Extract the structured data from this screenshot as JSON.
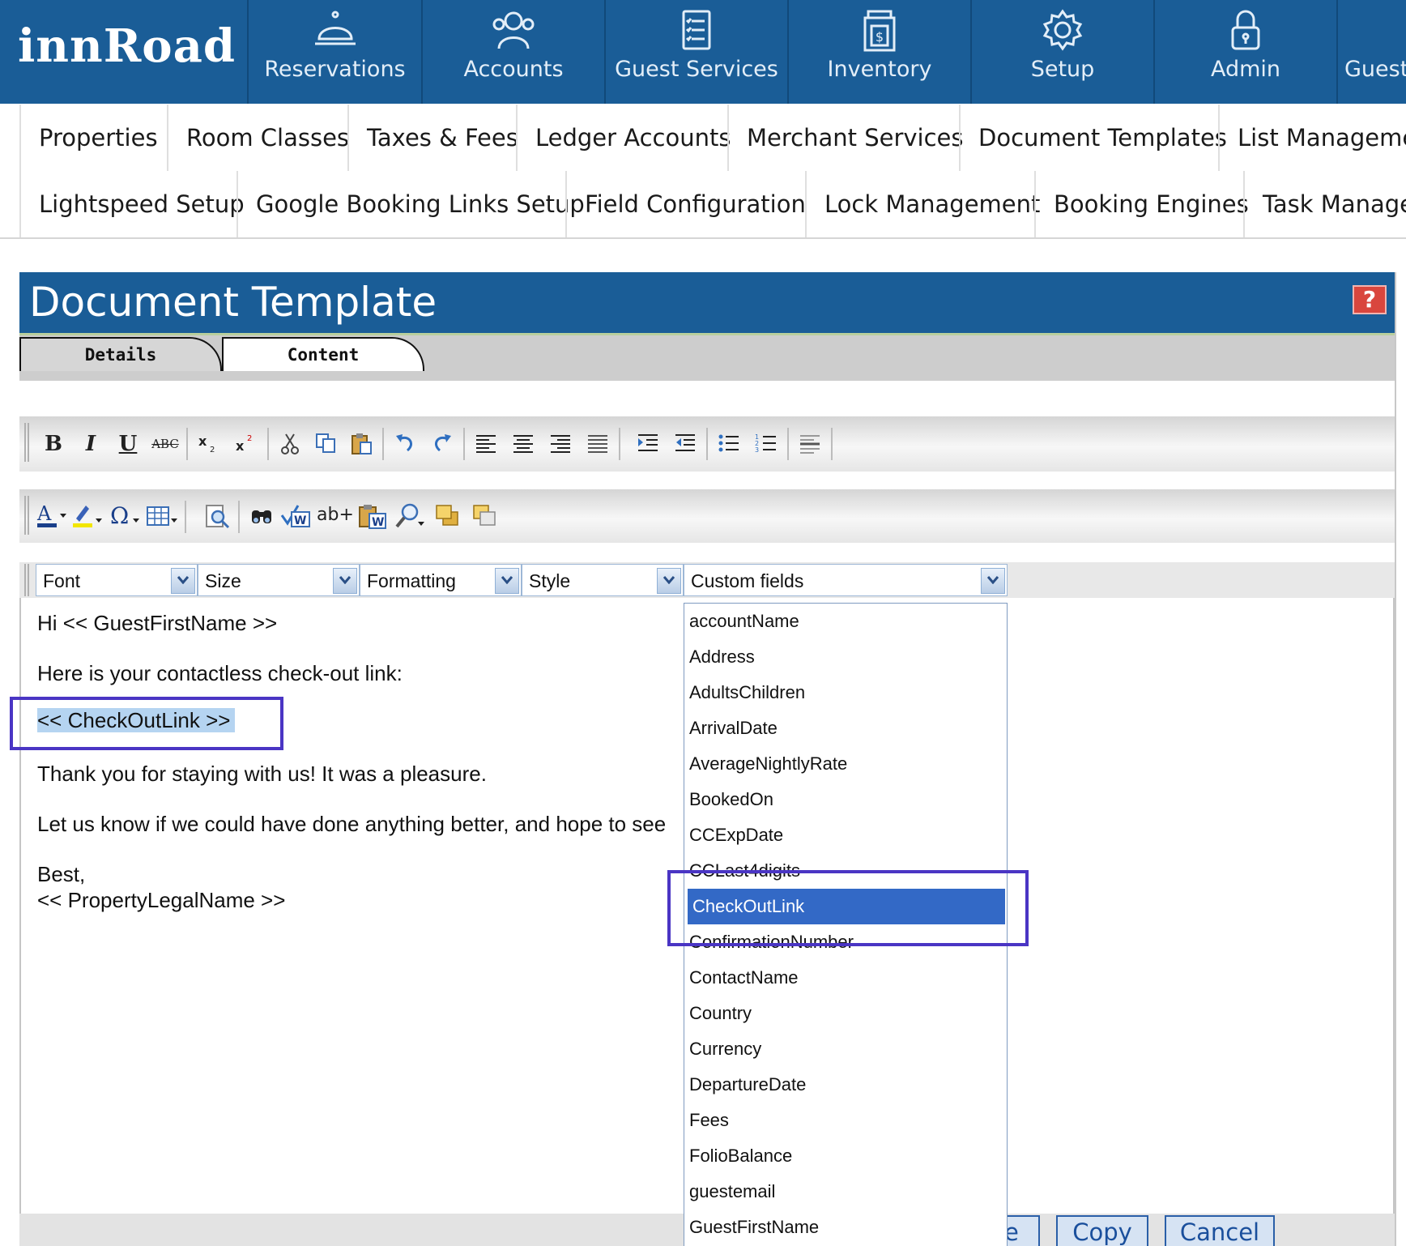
{
  "app": {
    "logo": "innRoad",
    "colors": {
      "nav_bg": "#1a5d97",
      "accent_highlight": "#4a35c4",
      "selected_option": "#3369c6",
      "text_selection": "#b5d4f1"
    }
  },
  "nav": {
    "items": [
      {
        "label": "Reservations",
        "icon": "bell-icon"
      },
      {
        "label": "Accounts",
        "icon": "users-icon"
      },
      {
        "label": "Guest Services",
        "icon": "checklist-icon"
      },
      {
        "label": "Inventory",
        "icon": "inventory-icon"
      },
      {
        "label": "Setup",
        "icon": "gear-icon"
      },
      {
        "label": "Admin",
        "icon": "lock-icon"
      },
      {
        "label": "Guest"
      }
    ]
  },
  "submenu": {
    "row1": [
      "Properties",
      "Room Classes",
      "Taxes & Fees",
      "Ledger Accounts",
      "Merchant Services",
      "Document Templates",
      "List Managemen"
    ],
    "row2": [
      "Lightspeed Setup",
      "Google Booking Links Setup",
      "Field Configuration",
      "Lock Management",
      "Booking Engines",
      "Task Manager"
    ]
  },
  "panel": {
    "title": "Document Template",
    "help": "?",
    "tabs": [
      {
        "label": "Details"
      },
      {
        "label": "Content",
        "active": true
      }
    ]
  },
  "toolbar": {
    "row1": [
      "bold",
      "italic",
      "underline",
      "strikethrough",
      "subscript",
      "superscript",
      "cut",
      "copy",
      "paste",
      "undo",
      "redo",
      "align-left",
      "align-center",
      "align-right",
      "justify",
      "indent",
      "outdent",
      "bulleted-list",
      "numbered-list",
      "horizontal-rule"
    ],
    "row2": [
      "font-color",
      "highlight-color",
      "special-character",
      "insert-table",
      "preview",
      "find",
      "spellcheck",
      "find-replace",
      "paste-from-word",
      "zoom",
      "bring-forward",
      "send-backward"
    ],
    "strike_label": "ABC",
    "insert_label": "ab+"
  },
  "dropdowns": {
    "font": "Font",
    "size": "Size",
    "formatting": "Formatting",
    "style": "Style",
    "custom_fields": "Custom fields"
  },
  "editor": {
    "line1": "Hi << GuestFirstName >>",
    "line2": "Here is your contactless check-out link:",
    "line3": "<< CheckOutLink >>",
    "line4": "Thank you for staying with us! It was a pleasure.",
    "line5": "Let us know if we could have done anything better, and hope to see",
    "line6": "Best,",
    "line7": "<< PropertyLegalName >>"
  },
  "custom_fields": {
    "options": [
      "accountName",
      "Address",
      "AdultsChildren",
      "ArrivalDate",
      "AverageNightlyRate",
      "BookedOn",
      "CCExpDate",
      "CCLast4digits",
      "CheckOutLink",
      "ConfirmationNumber",
      "ContactName",
      "Country",
      "Currency",
      "DepartureDate",
      "Fees",
      "FolioBalance",
      "guestemail",
      "GuestFirstName"
    ],
    "selected": "CheckOutLink"
  },
  "buttons": {
    "save_partial": "e",
    "copy": "Copy",
    "cancel": "Cancel"
  }
}
